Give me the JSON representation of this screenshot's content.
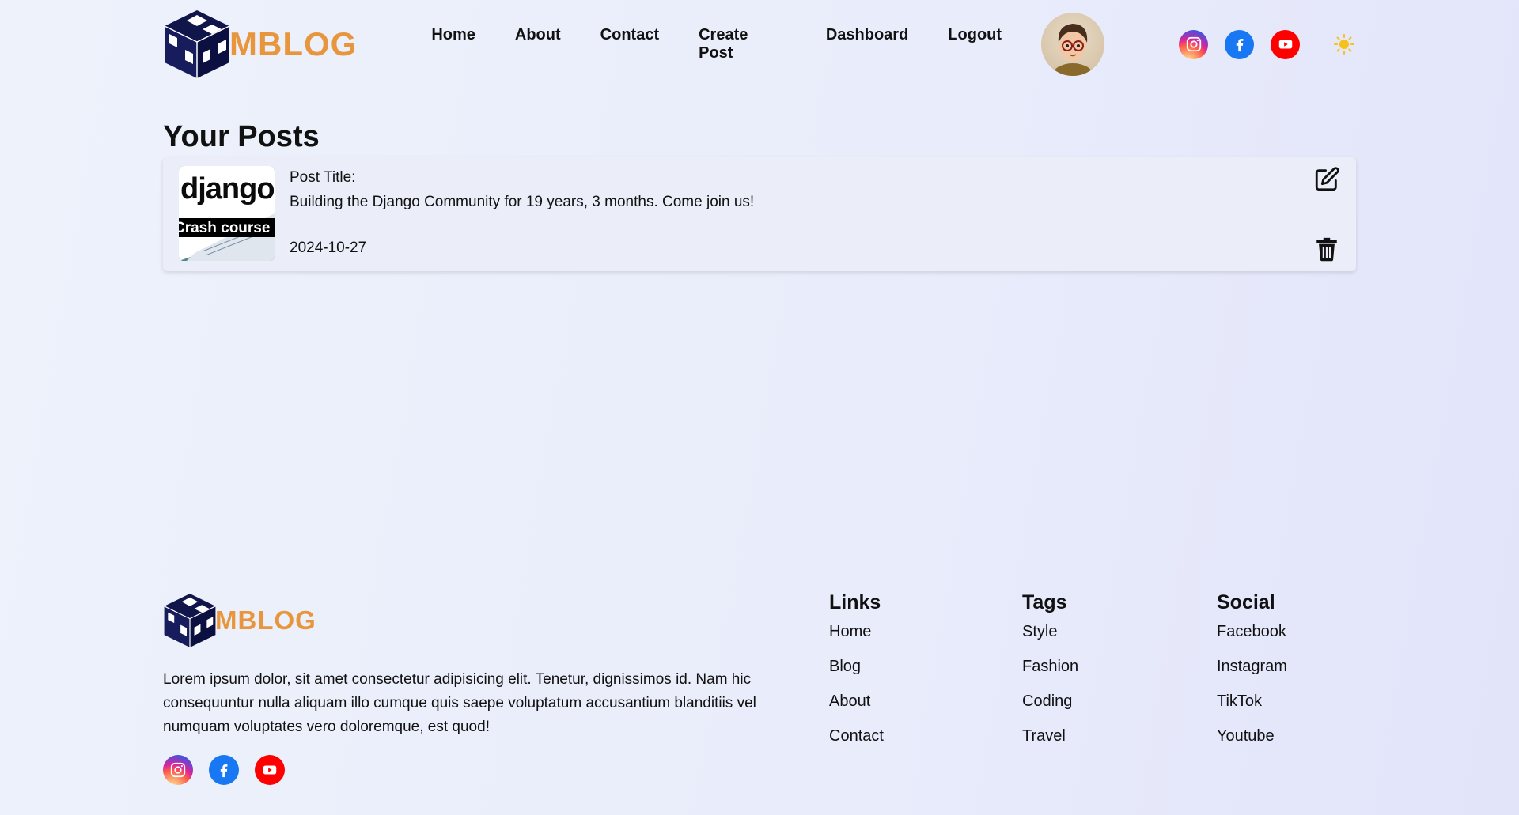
{
  "brand": {
    "logo_text": "MBLOG"
  },
  "nav": {
    "items": [
      {
        "label": "Home"
      },
      {
        "label": "About"
      },
      {
        "label": "Contact"
      },
      {
        "label": "Create Post"
      },
      {
        "label": "Dashboard"
      },
      {
        "label": "Logout"
      }
    ]
  },
  "social": {
    "icons": [
      "instagram-icon",
      "facebook-icon",
      "youtube-icon"
    ]
  },
  "theme": {
    "icon": "sun-icon",
    "color": "#f6c21a"
  },
  "posts_section": {
    "title": "Your Posts",
    "posts": [
      {
        "thumb_top": "django",
        "thumb_banner": "Crash course",
        "title_label": "Post Title:",
        "title": "Building the Django Community for 19 years, 3 months. Come join us!",
        "date": "2024-10-27"
      }
    ]
  },
  "footer": {
    "description": "Lorem ipsum dolor, sit amet consectetur adipisicing elit. Tenetur, dignissimos id. Nam hic consequuntur nulla aliquam illo cumque quis saepe voluptatum accusantium blanditiis vel numquam voluptates vero doloremque, est quod!",
    "columns": [
      {
        "title": "Links",
        "items": [
          "Home",
          "Blog",
          "About",
          "Contact"
        ]
      },
      {
        "title": "Tags",
        "items": [
          "Style",
          "Fashion",
          "Coding",
          "Travel"
        ]
      },
      {
        "title": "Social",
        "items": [
          "Facebook",
          "Instagram",
          "TikTok",
          "Youtube"
        ]
      }
    ]
  },
  "colors": {
    "accent": "#e8963d",
    "logo_cube": "#10154a",
    "facebook": "#1877f2",
    "youtube": "#ff0000"
  }
}
